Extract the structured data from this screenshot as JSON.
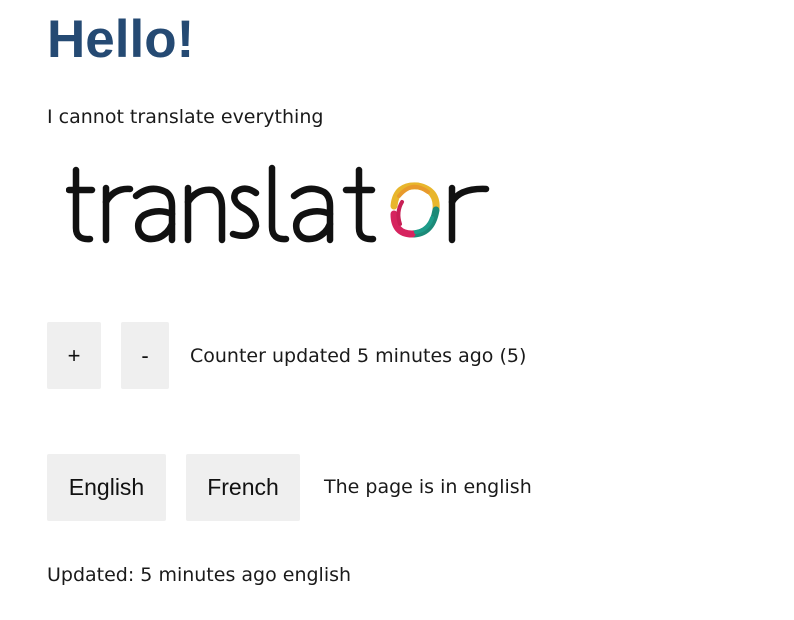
{
  "header": {
    "title": "Hello!",
    "subtitle": "I cannot translate everything"
  },
  "logo": {
    "text": "translator",
    "colors": [
      "#e8b62c",
      "#d6245f",
      "#1c8a78",
      "#1e9c8a"
    ]
  },
  "counter": {
    "increment_label": "+",
    "decrement_label": "-",
    "status": "Counter updated 5 minutes ago (5)"
  },
  "language": {
    "english_label": "English",
    "french_label": "French",
    "status": "The page is in english"
  },
  "footer": {
    "updated": "Updated: 5 minutes ago english"
  }
}
